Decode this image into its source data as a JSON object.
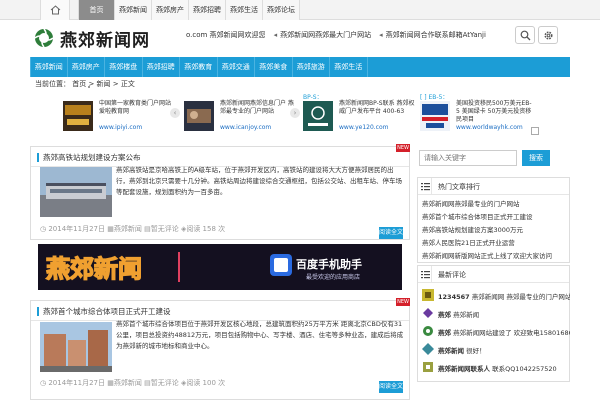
{
  "topnav": {
    "items": [
      {
        "label": "首页",
        "active": true
      },
      {
        "label": "燕郊新闻",
        "active": false
      },
      {
        "label": "燕郊房产",
        "active": false
      },
      {
        "label": "燕郊招聘",
        "active": false
      },
      {
        "label": "燕郊生活",
        "active": false
      },
      {
        "label": "燕郊论坛",
        "active": false
      }
    ]
  },
  "header": {
    "logo_text": "燕郊新闻网",
    "ticker": [
      {
        "text": "o.com  燕郊新闻网欢迎您"
      },
      {
        "text": "燕郊新闻网燕郊最大门户网站"
      },
      {
        "text": "燕郊新闻网合作联系邮箱AtYanjiao.com"
      },
      {
        "text": "燕郊新闻网欢迎您"
      }
    ]
  },
  "mainnav": {
    "items": [
      "燕郊新闻",
      "燕郊房产",
      "燕郊楼盘",
      "燕郊招聘",
      "燕郊教育",
      "燕郊交通",
      "燕郊美食",
      "燕郊旅游",
      "燕郊生活"
    ]
  },
  "breadcrumb": "当前位置： 首页 > 新闻 > 正文",
  "ads": [
    {
      "title": "中国第一家教育类门户网站 爱啦教育网",
      "url": "www.ipiyi.com"
    },
    {
      "title": "燕郊新闻网燕郊信息门户 燕郊最专业的门户网站",
      "url": "www.icanjoy.com"
    },
    {
      "head": "BP-S：",
      "title": "燕郊新闻网BP-S联系 燕郊权威门户发布平台 400-63",
      "url": "www.ye120.com"
    },
    {
      "head": "[  ] EB-5：",
      "title": "美国投资移民500万美元EB-5 美国绿卡 50万美元投资移民项目",
      "url": "www.worldwayhk.com"
    }
  ],
  "articles": [
    {
      "title": "燕郊高铁站规划建设方案公布",
      "body": "燕郊高铁站是京哈高铁上的A级车站，位于燕郊开发区内，高铁站的建设将大大方便燕郊居民的出行，燕郊到北京只需要十几分钟。高铁站周边将建设综合交通枢纽，包括公交站、出租车站、停车场等配套设施，规划面积约为一百多亩。",
      "date": "2014年11月27日",
      "category": "燕郊新闻",
      "comments": "暂无评论",
      "views": "阅读 158 次",
      "more": "阅读全文",
      "new_badge": "NEW"
    },
    {
      "title": "燕郊首个城市综合体项目正式开工建设",
      "body": "燕郊首个城市综合体项目位于燕郊开发区核心地段，总建筑面积约25万平方米 距离北京CBD仅有31公里，项目总投资约48812万元，项目包括购物中心、写字楼、酒店、住宅等多种业态，建成后将成为燕郊新的城市地标和商业中心。",
      "date": "2014年11月27日",
      "category": "燕郊新闻",
      "comments": "暂无评论",
      "views": "阅读 100 次",
      "more": "阅读全文",
      "new_badge": "NEW"
    }
  ],
  "banner": {
    "left_text": "燕郊新闻",
    "brand": "百度手机助手",
    "slogan": "最受欢迎的应用商店"
  },
  "sidebar": {
    "search_placeholder": "请输入关键字",
    "search_button": "搜索",
    "hot_title": "热门文章排行",
    "hot_items": [
      "燕郊新闻网燕郊最专业的门户网站",
      "燕郊首个城市综合体项目正式开工建设",
      "燕郊高铁站规划建设方案3000万元",
      "燕郊人民医院21日正式开业运营",
      "燕郊新闻网新版网站正式上线了欢迎大家访问"
    ],
    "comments_title": "最新评论",
    "comments": [
      {
        "user": "1234567",
        "text": "燕郊新闻网 燕郊最专业的门户网站欢迎大家访问"
      },
      {
        "user": "燕郊",
        "text": "燕郊新闻"
      },
      {
        "user": "燕郊",
        "text": "燕郊新闻网站建设了 欢迎致电15801686821燕郊"
      },
      {
        "user": "燕郊新闻",
        "text": "很好！"
      },
      {
        "user": "燕郊新闻网联系人",
        "text": "联系QQ1042257520"
      }
    ]
  }
}
